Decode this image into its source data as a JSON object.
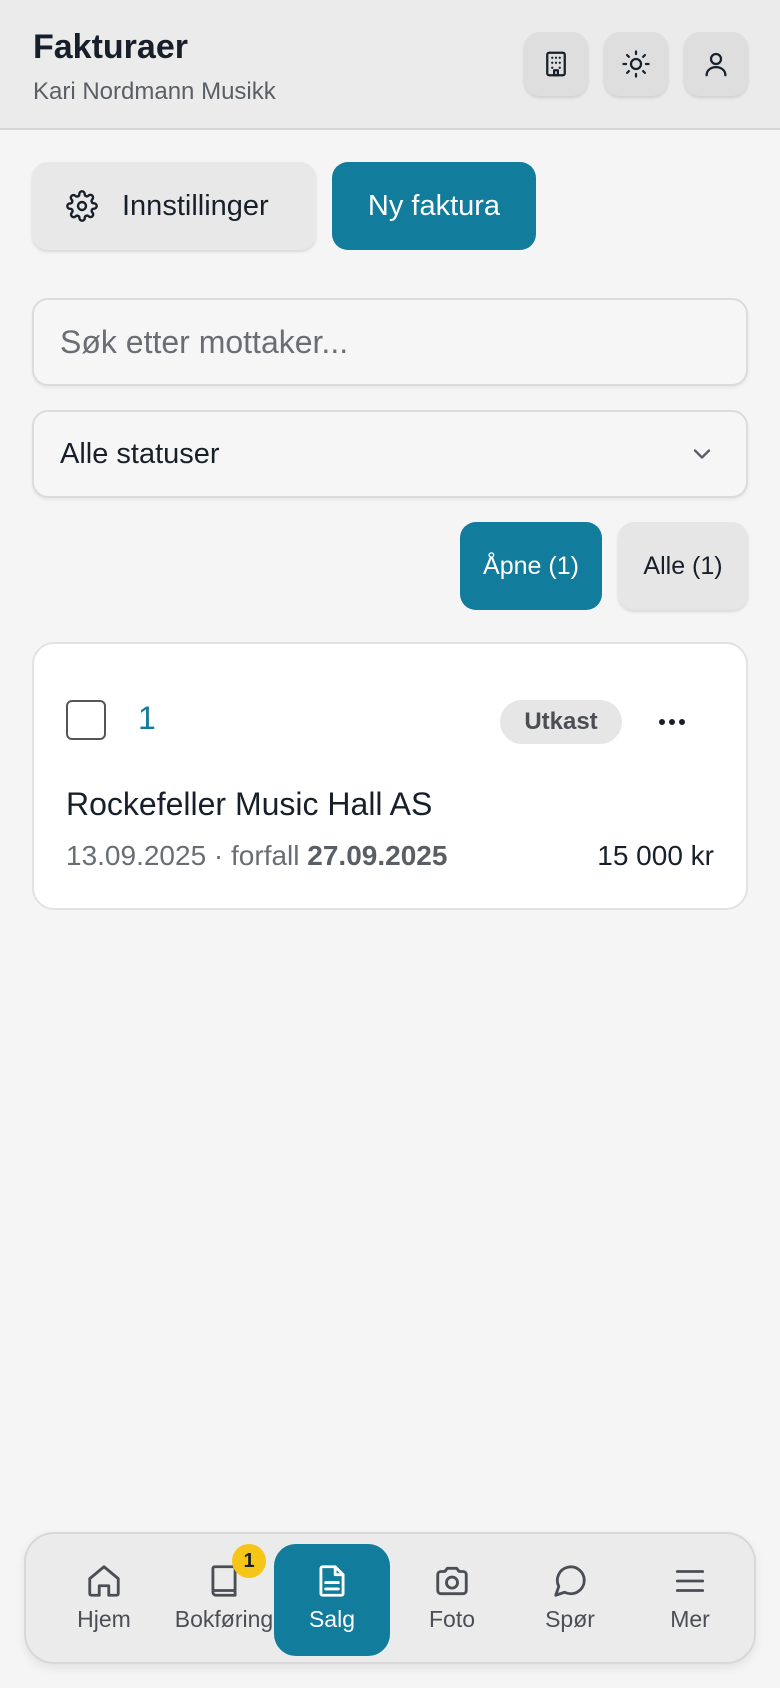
{
  "header": {
    "title": "Fakturaer",
    "subtitle": "Kari Nordmann Musikk",
    "icons": [
      "building-icon",
      "sun-icon",
      "user-icon"
    ]
  },
  "actions": {
    "settings_label": "Innstillinger",
    "new_invoice_label": "Ny faktura"
  },
  "search": {
    "placeholder": "Søk etter mottaker...",
    "value": ""
  },
  "status_select": {
    "selected": "Alle statuser"
  },
  "filters": {
    "open_label": "Åpne (1)",
    "all_label": "Alle (1)"
  },
  "invoices": [
    {
      "number": "1",
      "status": "Utkast",
      "customer": "Rockefeller Music Hall AS",
      "date": "13.09.2025",
      "due_prefix": " · forfall ",
      "due_date": "27.09.2025",
      "amount": "15 000 kr"
    }
  ],
  "nav": {
    "items": [
      {
        "label": "Hjem",
        "icon": "home-icon"
      },
      {
        "label": "Bokføring",
        "icon": "book-icon",
        "badge": "1"
      },
      {
        "label": "Salg",
        "icon": "document-icon",
        "active": true
      },
      {
        "label": "Foto",
        "icon": "camera-icon"
      },
      {
        "label": "Spør",
        "icon": "chat-icon"
      },
      {
        "label": "Mer",
        "icon": "menu-icon"
      }
    ]
  },
  "colors": {
    "accent": "#117c9c",
    "badge": "#f5c518",
    "background": "#f5f5f5"
  }
}
